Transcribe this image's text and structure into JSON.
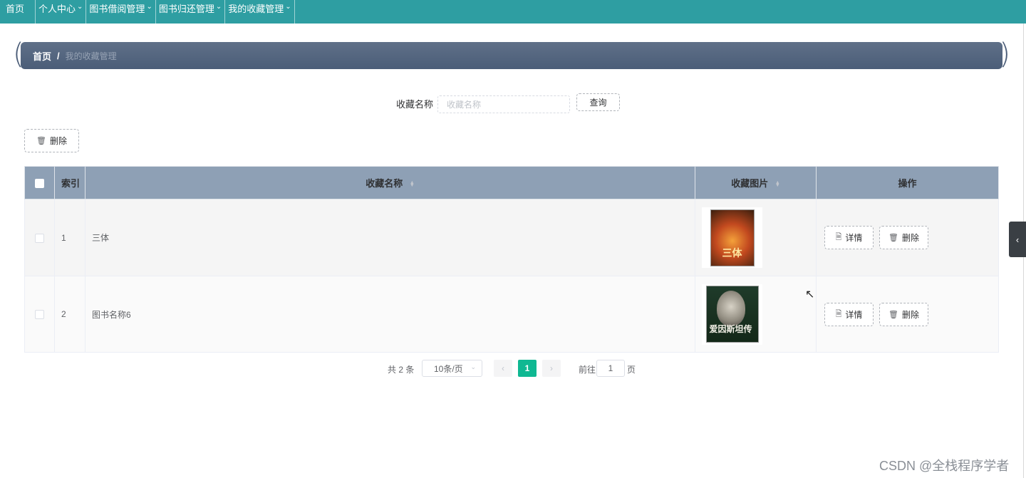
{
  "nav": {
    "items": [
      {
        "label": "首页",
        "dropdown": false
      },
      {
        "label": "个人中心",
        "dropdown": true
      },
      {
        "label": "图书借阅管理",
        "dropdown": true
      },
      {
        "label": "图书归还管理",
        "dropdown": true
      },
      {
        "label": "我的收藏管理",
        "dropdown": true
      }
    ],
    "color": "#2e9ea2"
  },
  "breadcrumb": {
    "home": "首页",
    "separator": "/",
    "current": "我的收藏管理"
  },
  "search": {
    "label": "收藏名称",
    "placeholder": "收藏名称",
    "value": "",
    "button": "查询"
  },
  "toolbar": {
    "delete_label": "删除"
  },
  "table": {
    "columns": [
      "索引",
      "收藏名称",
      "收藏图片",
      "操作"
    ],
    "rows": [
      {
        "index": "1",
        "name": "三体",
        "image": "三体 book cover",
        "cover_text": "三体",
        "detail": "详情",
        "delete": "删除"
      },
      {
        "index": "2",
        "name": "图书名称6",
        "image": "爱因斯坦传 book cover",
        "cover_text": "爱因斯坦传",
        "detail": "详情",
        "delete": "删除"
      }
    ]
  },
  "pagination": {
    "total": "共 2 条",
    "page_size": "10条/页",
    "current_page": "1",
    "goto_label": "前往",
    "goto_value": "1",
    "page_label": "页",
    "accent": "#0fb892"
  },
  "watermark": "CSDN @全栈程序学者"
}
